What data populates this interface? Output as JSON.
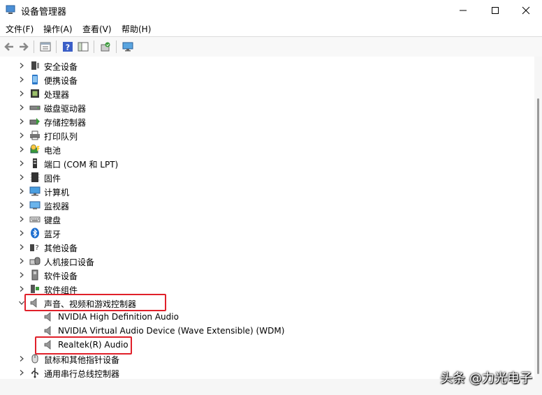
{
  "window": {
    "title": "设备管理器",
    "minimize": "—",
    "maximize": "☐",
    "close": "✕"
  },
  "menu": [
    "文件(F)",
    "操作(A)",
    "查看(V)",
    "帮助(H)"
  ],
  "tree": [
    {
      "label": "安全设备",
      "icon": "security-device-icon",
      "expanded": false
    },
    {
      "label": "便携设备",
      "icon": "portable-device-icon",
      "expanded": false
    },
    {
      "label": "处理器",
      "icon": "processor-icon",
      "expanded": false
    },
    {
      "label": "磁盘驱动器",
      "icon": "disk-drive-icon",
      "expanded": false
    },
    {
      "label": "存储控制器",
      "icon": "storage-controller-icon",
      "expanded": false
    },
    {
      "label": "打印队列",
      "icon": "printer-icon",
      "expanded": false
    },
    {
      "label": "电池",
      "icon": "battery-icon",
      "expanded": false
    },
    {
      "label": "端口 (COM 和 LPT)",
      "icon": "port-icon",
      "expanded": false
    },
    {
      "label": "固件",
      "icon": "firmware-icon",
      "expanded": false
    },
    {
      "label": "计算机",
      "icon": "computer-icon",
      "expanded": false
    },
    {
      "label": "监视器",
      "icon": "monitor-icon",
      "expanded": false
    },
    {
      "label": "键盘",
      "icon": "keyboard-icon",
      "expanded": false
    },
    {
      "label": "蓝牙",
      "icon": "bluetooth-icon",
      "expanded": false
    },
    {
      "label": "其他设备",
      "icon": "other-device-icon",
      "expanded": false
    },
    {
      "label": "人机接口设备",
      "icon": "hid-icon",
      "expanded": false
    },
    {
      "label": "软件设备",
      "icon": "software-device-icon",
      "expanded": false
    },
    {
      "label": "软件组件",
      "icon": "software-component-icon",
      "expanded": false
    },
    {
      "label": "声音、视频和游戏控制器",
      "icon": "speaker-icon",
      "expanded": true,
      "children": [
        {
          "label": "NVIDIA High Definition Audio",
          "icon": "speaker-icon"
        },
        {
          "label": "NVIDIA Virtual Audio Device (Wave Extensible) (WDM)",
          "icon": "speaker-icon"
        },
        {
          "label": "Realtek(R) Audio",
          "icon": "speaker-icon"
        }
      ]
    },
    {
      "label": "鼠标和其他指针设备",
      "icon": "mouse-icon",
      "expanded": false
    },
    {
      "label": "通用串行总线控制器",
      "icon": "usb-icon",
      "expanded": false
    }
  ],
  "watermark": "头条 @力光电子",
  "colors": {
    "highlight": "#e0202a"
  }
}
